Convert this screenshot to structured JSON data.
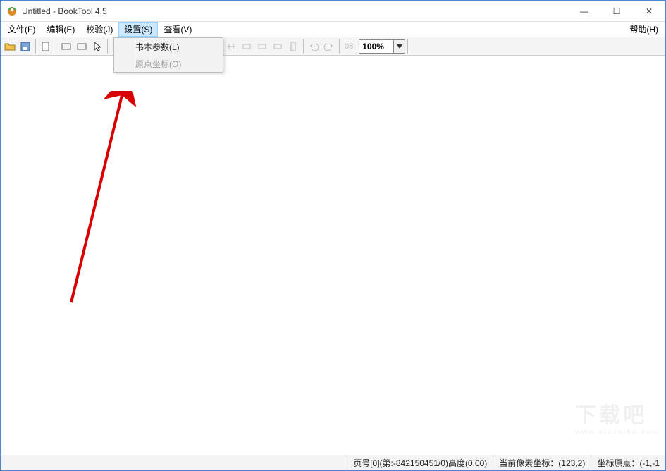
{
  "title": "Untitled - BookTool 4.5",
  "window_controls": {
    "minimize": "—",
    "maximize": "☐",
    "close": "✕"
  },
  "menu": {
    "items": [
      "文件(F)",
      "编辑(E)",
      "校验(J)",
      "设置(S)",
      "查看(V)"
    ],
    "active_index": 3,
    "help": "帮助(H)"
  },
  "dropdown": {
    "items": [
      {
        "label": "书本参数(L)",
        "enabled": true
      },
      {
        "label": "原点坐标(O)",
        "enabled": false
      }
    ]
  },
  "toolbar": {
    "zoom_value": "100%",
    "zoom_label": "08"
  },
  "status": {
    "page": "页号[0](第:-842150451/0)高度(0.00)",
    "cursor": "当前像素坐标：(123,2)",
    "origin": "坐标原点：(-1,-1"
  },
  "watermark": {
    "main": "下载吧",
    "sub": "www.xiazaiba.com"
  },
  "colors": {
    "accent": "#cce8ff",
    "accent_border": "#99d1ff",
    "arrow": "#d80000"
  }
}
